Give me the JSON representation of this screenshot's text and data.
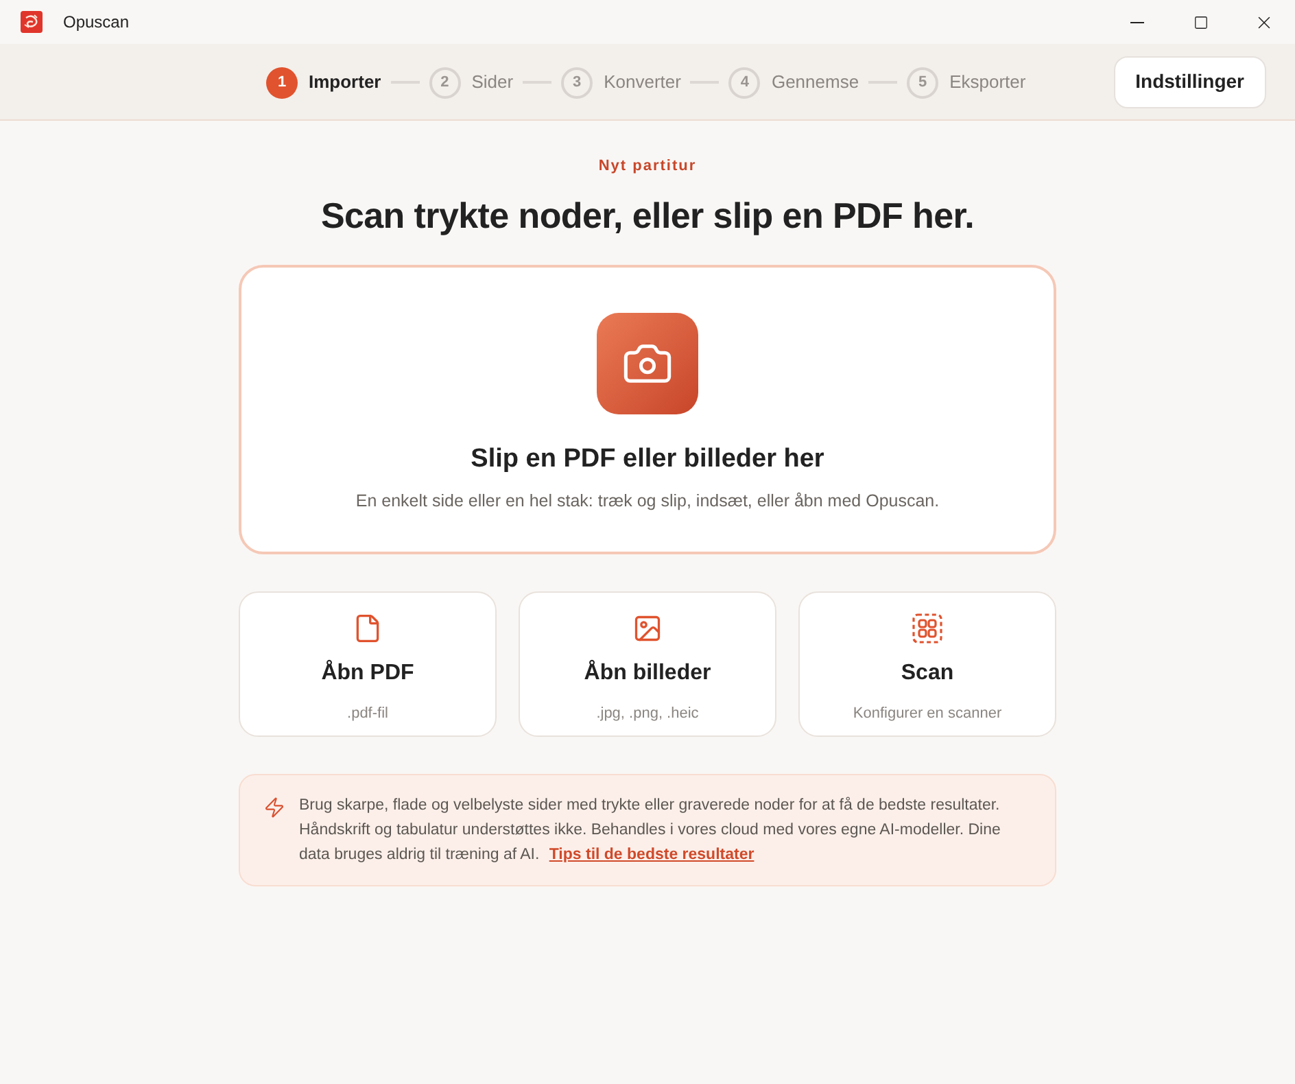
{
  "window": {
    "title": "Opuscan"
  },
  "steps": [
    {
      "number": "1",
      "label": "Importer",
      "selected": true
    },
    {
      "number": "2",
      "label": "Sider",
      "selected": false
    },
    {
      "number": "3",
      "label": "Konverter",
      "selected": false
    },
    {
      "number": "4",
      "label": "Gennemse",
      "selected": false
    },
    {
      "number": "5",
      "label": "Eksporter",
      "selected": false
    }
  ],
  "settings_button": "Indstillinger",
  "eyebrow": "Nyt partitur",
  "heading": "Scan trykte noder, eller slip en PDF her.",
  "drop_zone": {
    "title": "Slip en PDF eller billeder her",
    "subtitle": "En enkelt side eller en hel stak: træk og slip, indsæt, eller åbn med Opuscan."
  },
  "options": [
    {
      "kind": "pdf",
      "title": "Åbn PDF",
      "subtitle": ".pdf-fil"
    },
    {
      "kind": "images",
      "title": "Åbn billeder",
      "subtitle": ".jpg, .png, .heic"
    },
    {
      "kind": "scan",
      "title": "Scan",
      "subtitle": "Konfigurer en scanner"
    }
  ],
  "notice": {
    "text": "Brug skarpe, flade og velbelyste sider med trykte eller graverede noder for at få de bedste resultater. Håndskrift og tabulatur understøttes ikke. Behandles i vores cloud med vores egne AI-modeller. Dine data bruges aldrig til træning af AI.",
    "link": "Tips til de bedste resultater"
  }
}
